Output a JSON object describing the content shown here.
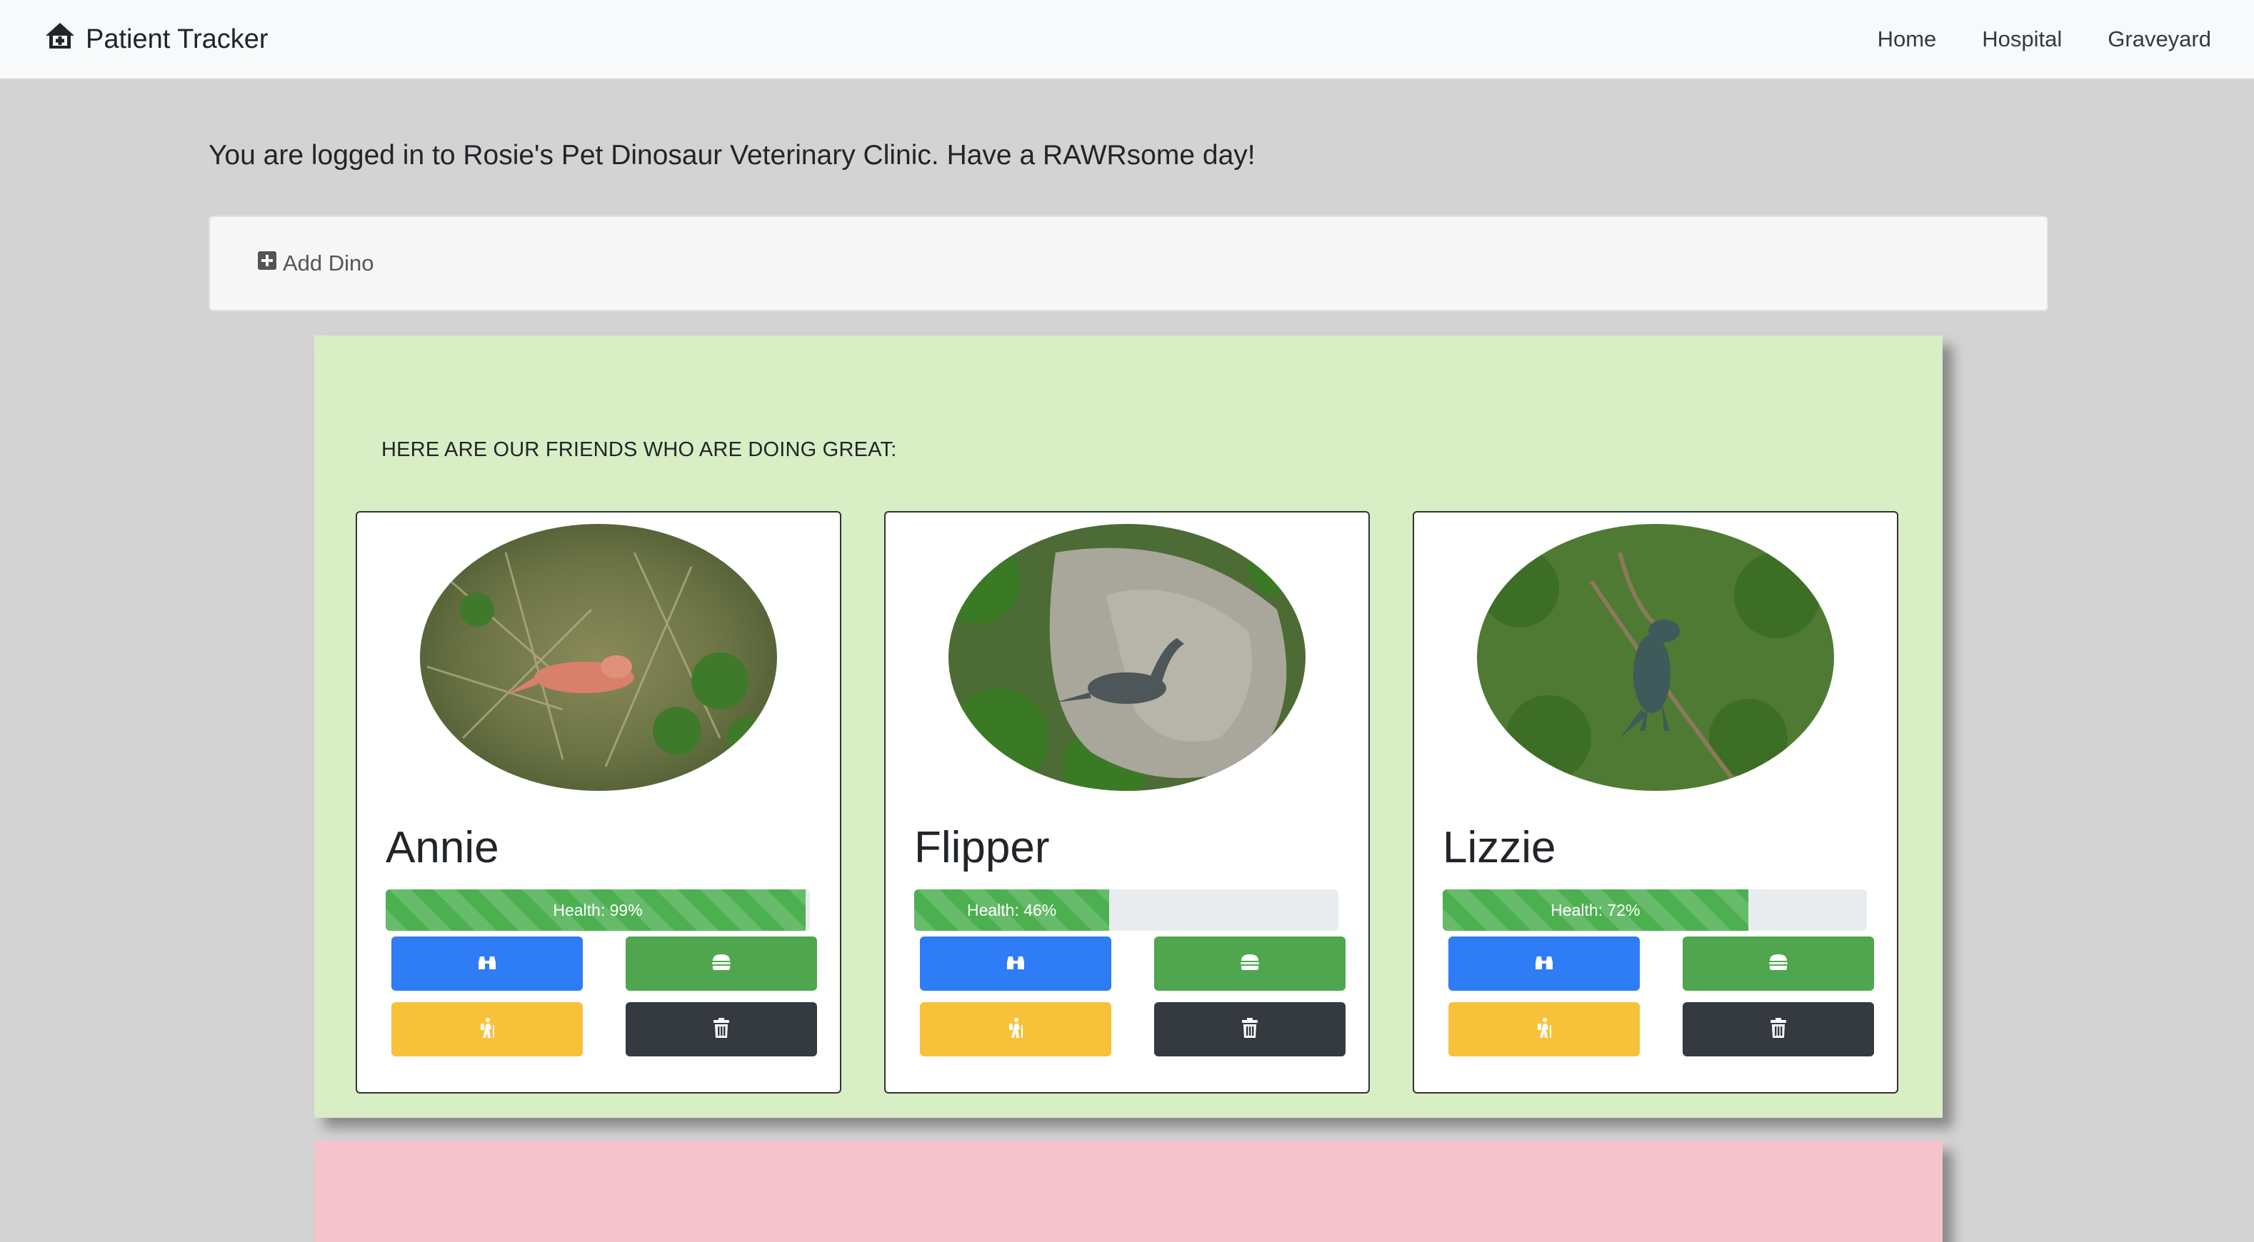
{
  "navbar": {
    "brand": "Patient Tracker",
    "links": [
      "Home",
      "Hospital",
      "Graveyard"
    ]
  },
  "welcome_message": "You are logged in to Rosie's Pet Dinosaur Veterinary Clinic. Have a RAWRsome day!",
  "add_panel": {
    "button_label": "Add Dino"
  },
  "sections": {
    "healthy": {
      "heading": "HERE ARE OUR FRIENDS WHO ARE DOING GREAT:",
      "background_color": "#d8eec5"
    },
    "critical": {
      "background_color": "#f5c3cc"
    }
  },
  "dinos": [
    {
      "name": "Annie",
      "health": 99,
      "health_label": "Health: 99%"
    },
    {
      "name": "Flipper",
      "health": 46,
      "health_label": "Health: 46%"
    },
    {
      "name": "Lizzie",
      "health": 72,
      "health_label": "Health: 72%"
    }
  ],
  "card_actions": {
    "view": {
      "icon": "binoculars-icon",
      "color": "#2e7cf6"
    },
    "feed": {
      "icon": "hamburger-icon",
      "color": "#4fa64f"
    },
    "adventure": {
      "icon": "hiking-icon",
      "color": "#f8c13a"
    },
    "delete": {
      "icon": "trash-icon",
      "color": "#343a40"
    }
  },
  "colors": {
    "navbar_bg": "#f8f9fa",
    "page_bg": "#d3d3d3",
    "progress_fill": "#4caf50"
  }
}
